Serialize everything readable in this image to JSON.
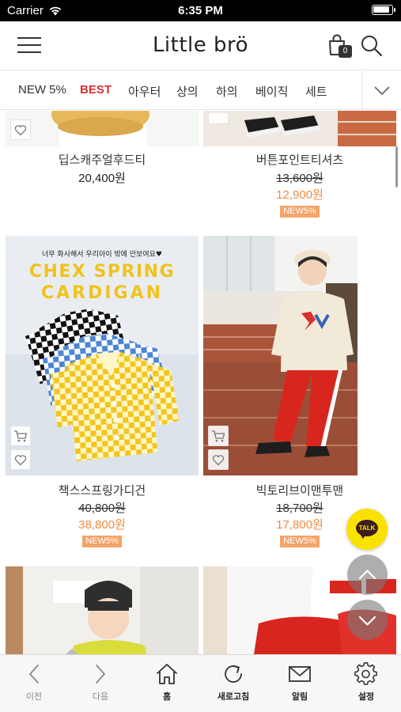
{
  "status_bar": {
    "carrier": "Carrier",
    "time": "6:35 PM"
  },
  "header": {
    "logo": "Little brö",
    "cart_count": "0"
  },
  "categories": [
    {
      "label": "NEW 5%",
      "active": false
    },
    {
      "label": "BEST",
      "active": true
    },
    {
      "label": "아우터",
      "active": false
    },
    {
      "label": "상의",
      "active": false
    },
    {
      "label": "하의",
      "active": false
    },
    {
      "label": "베이직",
      "active": false
    },
    {
      "label": "세트",
      "active": false
    }
  ],
  "products": [
    {
      "name": "딥스캐주얼후드티",
      "price": "20,400원"
    },
    {
      "name": "버튼포인트티셔츠",
      "original_price": "13,600원",
      "sale_price": "12,900원",
      "badge": "NEW5%"
    },
    {
      "name": "책스스프링가디건",
      "original_price": "40,800원",
      "sale_price": "38,800원",
      "badge": "NEW5%",
      "image_text": {
        "tagline": "너무 화사해서 우리아이 밖에 안보여요♥",
        "line1": "CHEX SPRING",
        "line2": "CARDIGAN"
      }
    },
    {
      "name": "빅토리브이맨투맨",
      "original_price": "18,700원",
      "sale_price": "17,800원",
      "badge": "NEW5%"
    }
  ],
  "talk_button": "TALK",
  "bottom_nav": [
    {
      "label": "이전",
      "icon": "chevron-left-icon"
    },
    {
      "label": "다음",
      "icon": "chevron-right-icon"
    },
    {
      "label": "홈",
      "icon": "home-icon"
    },
    {
      "label": "새로고침",
      "icon": "refresh-icon"
    },
    {
      "label": "알림",
      "icon": "mail-icon"
    },
    {
      "label": "설정",
      "icon": "gear-icon"
    }
  ],
  "colors": {
    "accent_red": "#d8312f",
    "sale_orange": "#f08a3e",
    "badge_bg": "#f4a468",
    "talk_yellow": "#fae100"
  }
}
